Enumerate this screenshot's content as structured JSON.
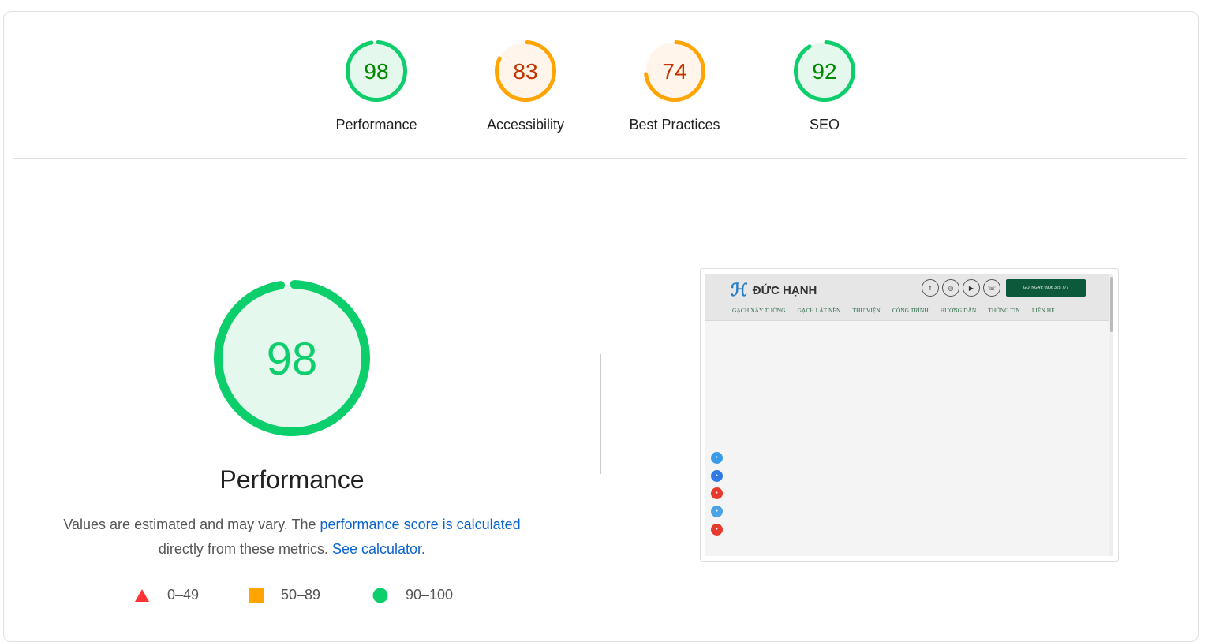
{
  "categories": [
    {
      "label": "Performance",
      "score": 98
    },
    {
      "label": "Accessibility",
      "score": 83
    },
    {
      "label": "Best Practices",
      "score": 74
    },
    {
      "label": "SEO",
      "score": 92
    }
  ],
  "colors": {
    "pass": "#0cce6b",
    "pass_fill": "#e5f8ee",
    "pass_text": "#008800",
    "average": "#ffa400",
    "average_fill": "#fff5ea",
    "average_text": "#c33300",
    "fail": "#ff3333"
  },
  "main": {
    "score": 98,
    "title": "Performance",
    "desc_1": "Values are estimated and may vary. The ",
    "link_1": "performance score is calculated",
    "desc_2": " directly from these metrics. ",
    "link_2": "See calculator.",
    "legend": [
      {
        "icon": "triangle",
        "range": "0–49"
      },
      {
        "icon": "square",
        "range": "50–89"
      },
      {
        "icon": "circle",
        "range": "90–100"
      }
    ]
  },
  "screenshot": {
    "logo": "ĐỨC HẠNH",
    "social": [
      "f",
      "◎",
      "▶",
      "☏"
    ],
    "call": "GỌI NGAY: 0906 325 777",
    "nav": [
      "GẠCH XÂY TƯỜNG",
      "GẠCH LÁT NỀN",
      "THƯ VIỆN",
      "CÔNG TRÌNH",
      "HƯỚNG DẪN",
      "THÔNG TIN",
      "LIÊN HỆ"
    ],
    "side_icons": [
      {
        "name": "email",
        "color": "#3b9be8"
      },
      {
        "name": "facebook",
        "color": "#2f7ae5"
      },
      {
        "name": "youtube",
        "color": "#e8392c"
      },
      {
        "name": "zalo",
        "color": "#4aa3e6"
      },
      {
        "name": "phone",
        "color": "#e53a2e"
      }
    ]
  }
}
